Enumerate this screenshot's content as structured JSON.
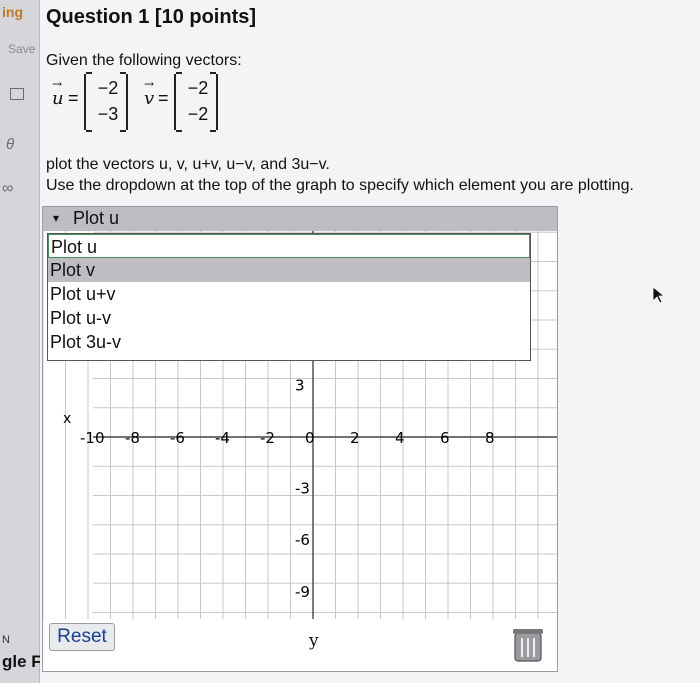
{
  "sidebar": {
    "items": [
      "ing",
      "Save",
      "θ",
      "∞",
      "N",
      "gle F"
    ]
  },
  "question": {
    "title": "Question 1 [10 points]",
    "given": "Given the following vectors:",
    "u_name": "u",
    "v_name": "v",
    "equals": "=",
    "u_components": [
      "−2",
      "−3"
    ],
    "v_components": [
      "−2",
      "−2"
    ],
    "instruction_1": "plot the vectors u, v, u+v, u−v, and 3u−v.",
    "instruction_2": "Use the dropdown at the top of the graph to specify which element you are plotting."
  },
  "graph": {
    "dropdown_label": "Plot u",
    "dropdown_caret": "▾",
    "options": [
      "Plot u",
      "Plot v",
      "Plot u+v",
      "Plot u-v",
      "Plot 3u-v"
    ],
    "selected_index": 0,
    "highlighted_index": 1,
    "x_tick_labels": [
      "-10",
      "-8",
      "-6",
      "-4",
      "-2",
      "0",
      "2",
      "4",
      "6",
      "8"
    ],
    "y_tick_labels": [
      "3",
      "-3",
      "-6",
      "-9"
    ],
    "x_axis_label": "x",
    "y_axis_label": "y",
    "reset_label": "Reset",
    "colors": {
      "selected_outline": "#4a8f5a",
      "reset_text": "#17408f",
      "highlight": "#bdbdc2"
    }
  }
}
